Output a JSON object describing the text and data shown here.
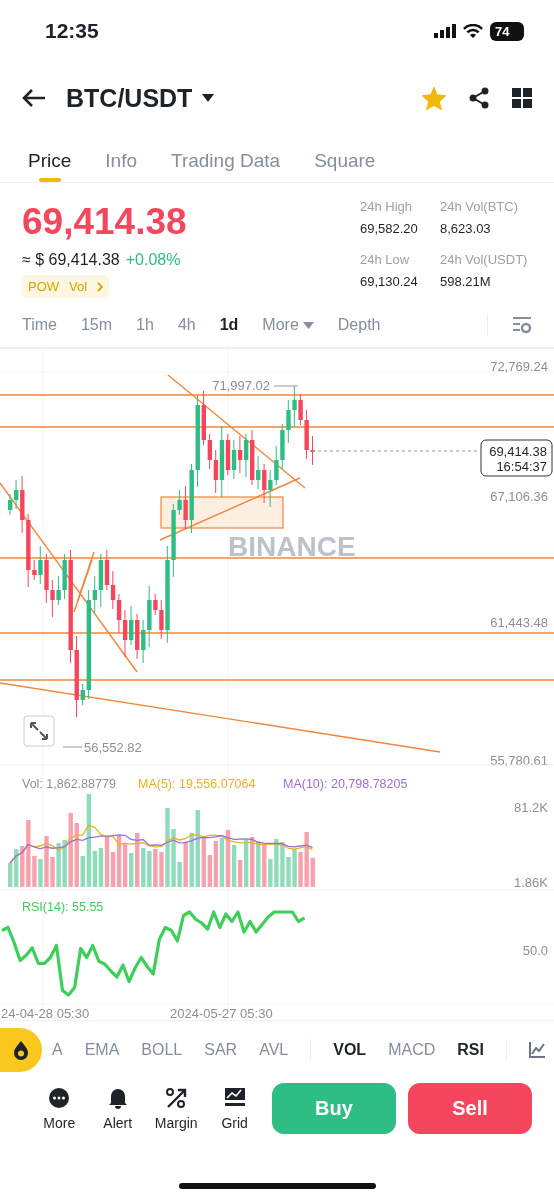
{
  "status_bar": {
    "time": "12:35",
    "battery": "74"
  },
  "header": {
    "pair": "BTC/USDT",
    "favorite": true
  },
  "tabs": [
    {
      "label": "Price",
      "selected": true
    },
    {
      "label": "Info",
      "selected": false
    },
    {
      "label": "Trading Data",
      "selected": false
    },
    {
      "label": "Square",
      "selected": false
    }
  ],
  "ticker": {
    "last_price": "69,414.38",
    "fiat_price": "≈ $ 69,414.38",
    "change": "+0.08%",
    "tags": [
      "POW",
      "Vol"
    ],
    "stats": [
      {
        "label": "24h High",
        "value": "69,582.20"
      },
      {
        "label": "24h Vol(BTC)",
        "value": "8,623.03"
      },
      {
        "label": "24h Low",
        "value": "69,130.24"
      },
      {
        "label": "24h Vol(USDT)",
        "value": "598.21M"
      }
    ]
  },
  "intervals": [
    {
      "label": "Time",
      "kind": "option",
      "selected": false
    },
    {
      "label": "15m",
      "kind": "option",
      "selected": false
    },
    {
      "label": "1h",
      "kind": "option",
      "selected": false
    },
    {
      "label": "4h",
      "kind": "option",
      "selected": false
    },
    {
      "label": "1d",
      "kind": "option",
      "selected": true
    },
    {
      "label": "More",
      "kind": "dropdown",
      "selected": false
    },
    {
      "label": "Depth",
      "kind": "option",
      "selected": false
    }
  ],
  "chart": {
    "price_axis": [
      "72,769.24",
      "67,106.36",
      "61,443.48",
      "55,780.61"
    ],
    "high_marker": "71,997.02",
    "low_marker": "56,552.82",
    "last_price": "69,414.38",
    "countdown": "16:54:37",
    "watermark": "BINANCE",
    "volume": {
      "legend": [
        {
          "text": "Vol: 1,862.88779",
          "color": "#8a8f99"
        },
        {
          "text": "MA(5): 19,556.07064",
          "color": "#e8b21e"
        },
        {
          "text": "MA(10): 20,798.78205",
          "color": "#9d6fcf"
        }
      ],
      "axis": [
        "81.2K",
        "1.86K"
      ]
    },
    "rsi": {
      "legend": "RSI(14): 55.55",
      "axis": "50.0"
    },
    "time_axis": [
      "24-04-28 05:30",
      "2024-05-27 05:30"
    ]
  },
  "indicators": [
    {
      "label": "A",
      "selected": false
    },
    {
      "label": "EMA",
      "selected": false
    },
    {
      "label": "BOLL",
      "selected": false
    },
    {
      "label": "SAR",
      "selected": false
    },
    {
      "label": "AVL",
      "selected": false
    },
    {
      "label": "VOL",
      "selected": true
    },
    {
      "label": "MACD",
      "selected": false
    },
    {
      "label": "RSI",
      "selected": true
    }
  ],
  "actions": [
    {
      "label": "More",
      "kind": "more"
    },
    {
      "label": "Alert",
      "kind": "alert"
    },
    {
      "label": "Margin",
      "kind": "margin"
    },
    {
      "label": "Grid",
      "kind": "grid"
    }
  ],
  "buy": "Buy",
  "sell": "Sell"
}
